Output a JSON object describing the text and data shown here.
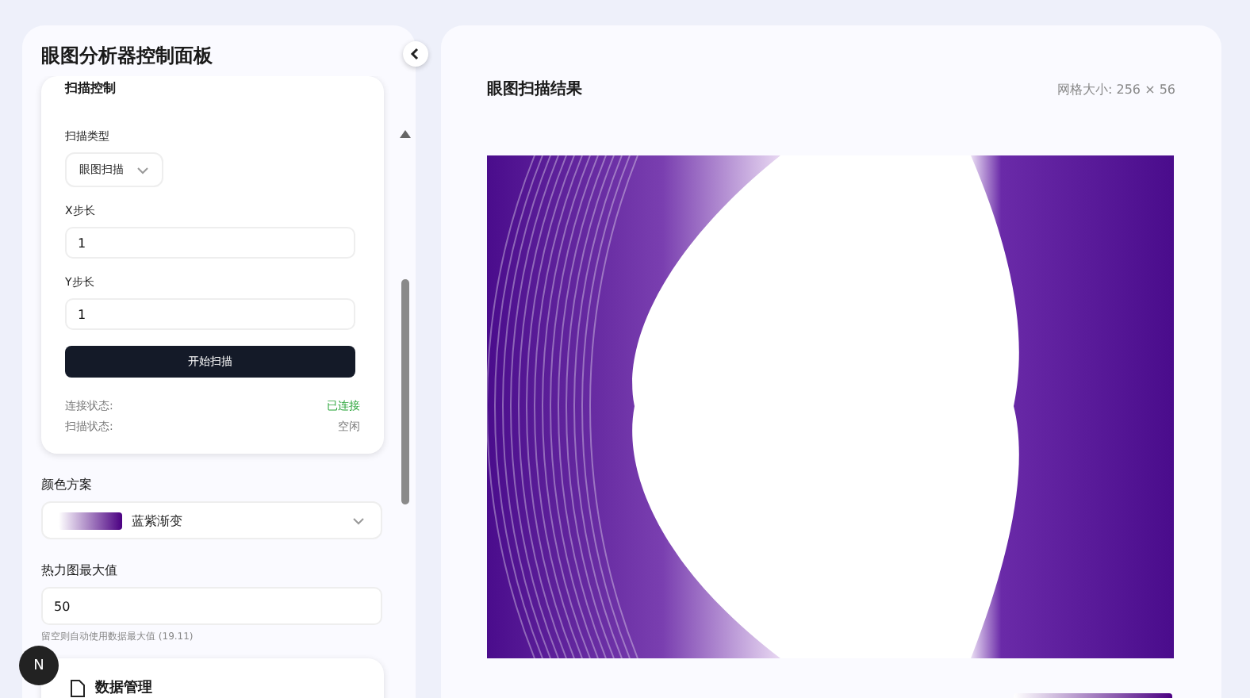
{
  "sidebar": {
    "title": "眼图分析器控制面板",
    "scan_card": {
      "title": "扫描控制",
      "scan_type": {
        "label": "扫描类型",
        "value": "眼图扫描"
      },
      "x_step": {
        "label": "X步长",
        "value": "1"
      },
      "y_step": {
        "label": "Y步长",
        "value": "1"
      },
      "start_button": "开始扫描",
      "status": [
        {
          "label": "连接状态:",
          "value": "已连接",
          "kind": "ok"
        },
        {
          "label": "扫描状态:",
          "value": "空闲",
          "kind": "plain"
        }
      ]
    },
    "color_scheme": {
      "label": "颜色方案",
      "value": "蓝紫渐变"
    },
    "heatmap_max": {
      "label": "热力图最大值",
      "value": "50",
      "hint": "留空则自动使用数据最大值 (19.11)"
    },
    "data_card": {
      "title": "数据管理"
    }
  },
  "avatar_letter": "N",
  "result": {
    "title": "眼图扫描结果",
    "grid_size": "网格大小: 256 × 56"
  }
}
